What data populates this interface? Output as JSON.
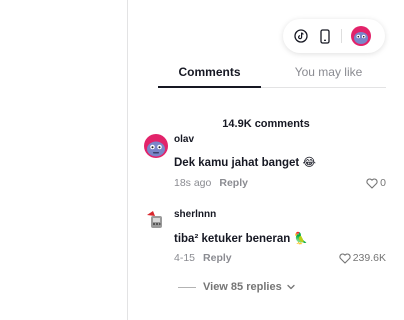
{
  "toolbar": {
    "icons": [
      "tiktok-icon",
      "phone-icon"
    ],
    "avatar": "user-avatar"
  },
  "tabs": [
    {
      "label": "Comments",
      "active": true
    },
    {
      "label": "You may like",
      "active": false
    }
  ],
  "comments_count": "14.9K comments",
  "comments": [
    {
      "user": "olav",
      "text": "Dek kamu jahat banget",
      "emoji": "😂",
      "time": "18s ago",
      "reply_label": "Reply",
      "likes": "0"
    },
    {
      "user": "sherlnnn",
      "text": "tiba² ketuker beneran",
      "emoji": "🦜",
      "time": "4-15",
      "reply_label": "Reply",
      "likes": "239.6K"
    }
  ],
  "view_replies": "View 85 replies",
  "colors": {
    "text": "#161823",
    "muted": "#8a8b91",
    "divider": "#e3e3e4",
    "avatar_pink": "#e2236a"
  }
}
